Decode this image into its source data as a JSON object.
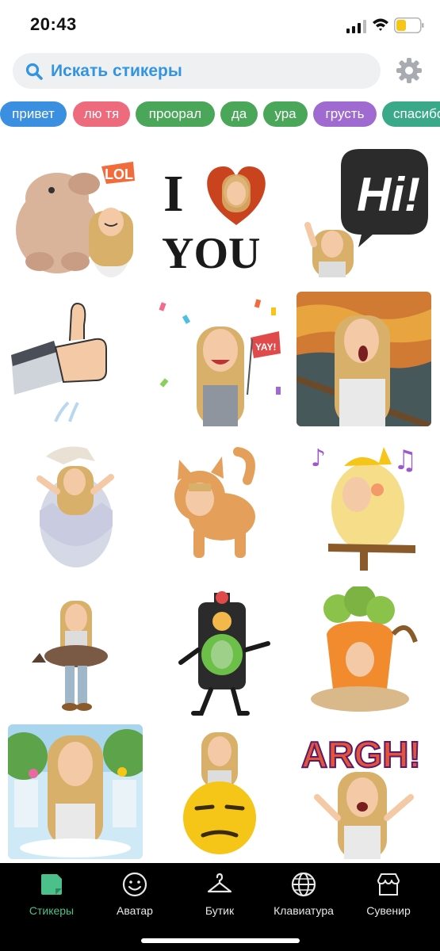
{
  "status_bar": {
    "time": "20:43",
    "battery_color": "#f5c518"
  },
  "search": {
    "placeholder": "Искать стикеры",
    "accent": "#3394e0",
    "icon": "search-icon"
  },
  "settings": {
    "icon": "gear-icon"
  },
  "chips": [
    {
      "label": "привет",
      "color": "#3a8fe0"
    },
    {
      "label": "лю тя",
      "color": "#ee6b7e"
    },
    {
      "label": "проорал",
      "color": "#4aa75a"
    },
    {
      "label": "да",
      "color": "#4aa75a"
    },
    {
      "label": "ура",
      "color": "#4aa75a"
    },
    {
      "label": "грусть",
      "color": "#a06bd0"
    },
    {
      "label": "спасибо",
      "color": "#3aa98a"
    }
  ],
  "stickers": [
    {
      "name": "lol-waterbear",
      "text": "LOL"
    },
    {
      "name": "i-love-you",
      "text_top": "I",
      "text_bottom": "YOU"
    },
    {
      "name": "hi-speech-bubble",
      "text": "Hi!"
    },
    {
      "name": "thumbs-up"
    },
    {
      "name": "yay-confetti",
      "text": "YAY!"
    },
    {
      "name": "scream-painting"
    },
    {
      "name": "hatching-egg"
    },
    {
      "name": "cat-costume"
    },
    {
      "name": "singing-bird"
    },
    {
      "name": "platypus"
    },
    {
      "name": "traffic-light"
    },
    {
      "name": "carrot-costume"
    },
    {
      "name": "waterfall-meditation"
    },
    {
      "name": "unamused-emoji"
    },
    {
      "name": "argh",
      "text": "ARGH!"
    }
  ],
  "tabs": [
    {
      "label": "Стикеры",
      "icon": "sticker-icon",
      "active": true
    },
    {
      "label": "Аватар",
      "icon": "smiley-icon",
      "active": false
    },
    {
      "label": "Бутик",
      "icon": "hanger-icon",
      "active": false
    },
    {
      "label": "Клавиатура",
      "icon": "globe-icon",
      "active": false
    },
    {
      "label": "Сувенир",
      "icon": "shop-icon",
      "active": false
    }
  ]
}
